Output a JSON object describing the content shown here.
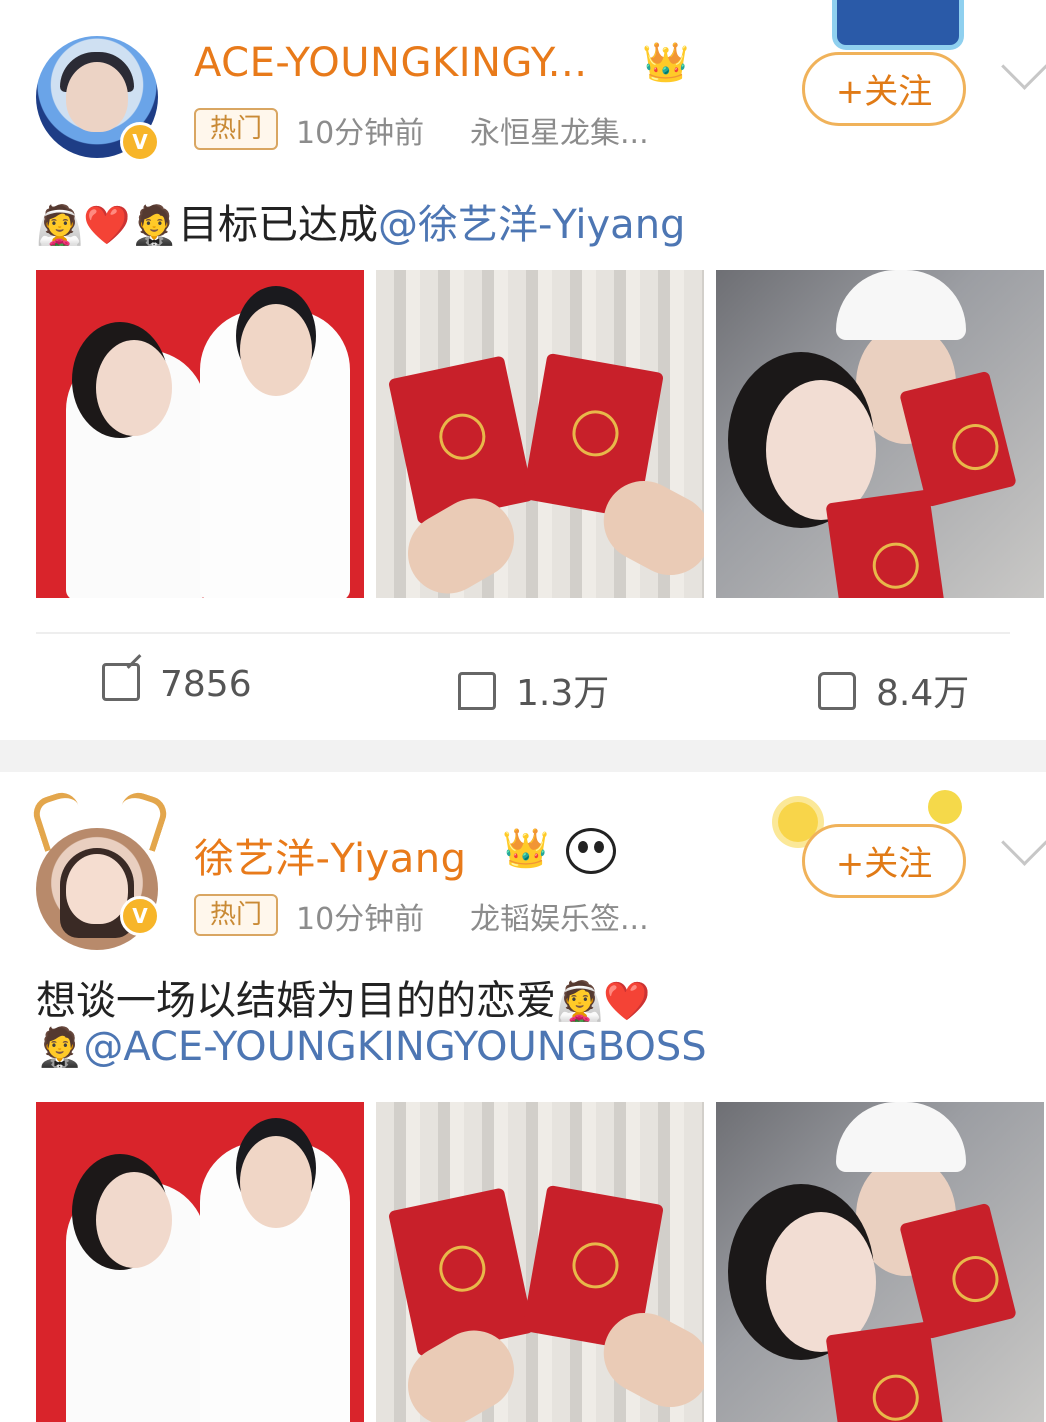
{
  "posts": [
    {
      "username": "ACE-YOUNGKINGY...",
      "hot_label": "热门",
      "time": "10分钟前",
      "source": "永恒星龙集...",
      "follow_label": "+关注",
      "text_emoji_prefix": "👰❤️🤵",
      "text": "目标已达成",
      "mention": "@徐艺洋-Yiyang",
      "actions": {
        "repost": "7856",
        "comment": "1.3万",
        "like": "8.4万"
      }
    },
    {
      "username": "徐艺洋-Yiyang",
      "hot_label": "热门",
      "time": "10分钟前",
      "source": "龙韬娱乐签...",
      "follow_label": "+关注",
      "text": "想谈一场以结婚为目的的恋爱",
      "text_emoji_suffix": "👰❤️",
      "line2_emoji": "🤵",
      "mention": "@ACE-YOUNGKINGYOUNGBOSS"
    }
  ],
  "icons": {
    "verified": "V",
    "crown": "👑",
    "panda": "panda-icon",
    "repost": "repost-icon",
    "comment": "comment-icon",
    "like": "like-icon",
    "chevron": "chevron-down-icon"
  },
  "colors": {
    "username": "#e87a1a",
    "mention": "#4d76b3",
    "follow_border": "#f0b25a",
    "verified": "#f7b529",
    "meta": "#8c8c8c"
  }
}
